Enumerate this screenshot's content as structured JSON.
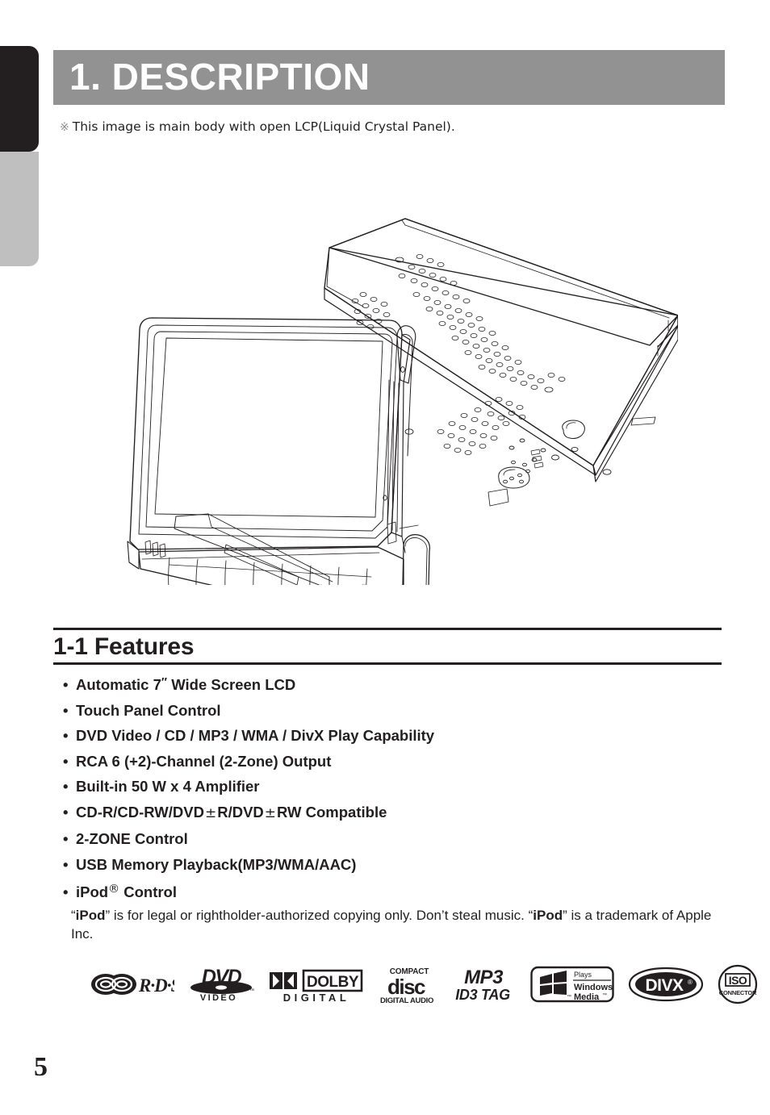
{
  "document": {
    "page_number": "5"
  },
  "chapter": {
    "title": "1. DESCRIPTION",
    "bar_color": "#929292",
    "title_color": "#ffffff"
  },
  "note": {
    "mark": "※",
    "text": "This image is main body with open LCP(Liquid Crystal Panel)."
  },
  "illustration": {
    "name": "car-av-head-unit-with-open-lcd-panel",
    "caption_ref": "main body with open LCP"
  },
  "features": {
    "heading": "1-1 Features",
    "bullet": "•",
    "items": [
      {
        "text_before": "Automatic 7",
        "inch": "″",
        "text_after": " Wide Screen LCD",
        "type": "inch"
      },
      {
        "text": "Touch Panel Control",
        "type": "plain"
      },
      {
        "text": "DVD Video / CD / MP3 / WMA / DivX Play Capability",
        "type": "plain"
      },
      {
        "text": "RCA 6 (+2)-Channel (2-Zone) Output",
        "type": "plain"
      },
      {
        "text": "Built-in 50 W x 4 Amplifier",
        "type": "plain"
      },
      {
        "segments": [
          "CD-R/CD-RW/DVD",
          "R/DVD",
          "RW Compatible"
        ],
        "sign": "±",
        "type": "plusminus"
      },
      {
        "text": "2-ZONE Control",
        "type": "plain"
      },
      {
        "text": "USB Memory Playback(MP3/WMA/AAC)",
        "type": "plain"
      },
      {
        "text_before": "iPod",
        "reg": "®",
        "text_after": " Control",
        "type": "registered"
      }
    ]
  },
  "ipod_note": {
    "line1_a": "“",
    "brand1": "iPod",
    "line1_b": "” is for legal or rightholder-authorized copying only. Don’t steal music. “",
    "brand2": "iPod",
    "line1_c": "” is a trademark of Apple Inc."
  },
  "logos": [
    {
      "name": "rds-logo",
      "label": "R·D·S"
    },
    {
      "name": "dvd-video-logo",
      "label_top": "DVD",
      "label_bottom": "V I D E O",
      "tm": "™"
    },
    {
      "name": "dolby-digital-logo",
      "label_top": "DOLBY",
      "label_bottom": "D I G I T A L"
    },
    {
      "name": "compact-disc-digital-audio-logo",
      "label_top": "COMPACT",
      "label_mid": "disc",
      "label_bottom": "DIGITAL AUDIO"
    },
    {
      "name": "mp3-id3-tag-logo",
      "label_top": "MP3",
      "label_bottom": "ID3 TAG"
    },
    {
      "name": "plays-windows-media-logo",
      "label_top": "Plays",
      "label_mid": "Windows",
      "label_bottom": "Media",
      "tm": "™"
    },
    {
      "name": "divx-logo",
      "label": "DIVX",
      "reg": "®"
    },
    {
      "name": "iso-connector-logo",
      "label_top": "ISO",
      "label_bottom": "CONNECTOR"
    }
  ]
}
